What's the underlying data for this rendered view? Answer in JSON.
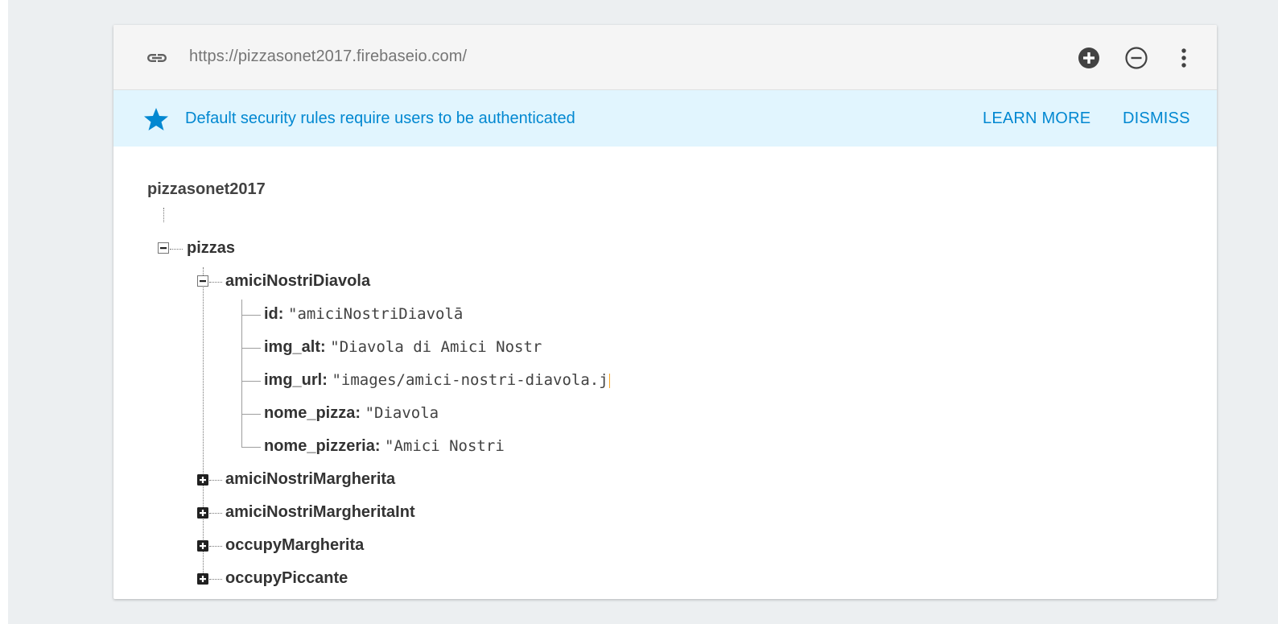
{
  "urlbar": {
    "url": "https://pizzasonet2017.firebaseio.com/",
    "link_icon": "link-icon",
    "add_icon": "add-circle-icon",
    "remove_icon": "remove-circle-icon",
    "more_icon": "more-vert-icon"
  },
  "banner": {
    "star_icon": "star-icon",
    "message": "Default security rules require users to be authenticated",
    "learn_more": "LEARN MORE",
    "dismiss": "DISMISS",
    "accent": "#0288d1",
    "background": "#e1f5fe"
  },
  "tree": {
    "root": "pizzasonet2017",
    "pizzas_key": "pizzas",
    "expanded_child": {
      "key": "amiciNostriDiavola",
      "fields": [
        {
          "key": "id:",
          "value": "\"amiciNostriDiavolā"
        },
        {
          "key": "img_alt:",
          "value": "\"Diavola di Amici Nostr"
        },
        {
          "key": "img_url:",
          "value": "\"images/amici-nostri-diavola.j"
        },
        {
          "key": "nome_pizza:",
          "value": "\"Diavola"
        },
        {
          "key": "nome_pizzeria:",
          "value": "\"Amici Nostri"
        }
      ]
    },
    "collapsed_children": [
      "amiciNostriMargherita",
      "amiciNostriMargheritaInt",
      "occupyMargherita",
      "occupyPiccante"
    ]
  }
}
